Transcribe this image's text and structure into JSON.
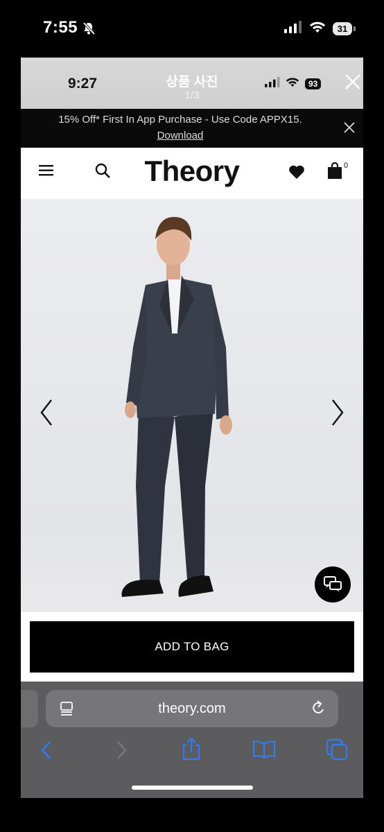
{
  "outer_status": {
    "time": "7:55",
    "battery": "31"
  },
  "viewer": {
    "time": "9:27",
    "title": "상품 사진",
    "counter": "1/3",
    "battery": "93"
  },
  "promo": {
    "text": "15% Off* First In App Purchase - Use Code APPX15.",
    "link": "Download"
  },
  "header": {
    "logo": "Theory",
    "cart_count": "0"
  },
  "product": {
    "add_to_bag": "ADD TO BAG"
  },
  "browser": {
    "url": "theory.com"
  },
  "icons": [
    "bell-slash-icon",
    "signal-icon",
    "wifi-icon",
    "battery-icon",
    "close-icon",
    "menu-icon",
    "search-icon",
    "heart-icon",
    "bag-icon",
    "chevron-left-icon",
    "chevron-right-icon",
    "chat-icon",
    "reader-icon",
    "reload-icon",
    "back-icon",
    "forward-icon",
    "share-icon",
    "bookmarks-icon",
    "tabs-icon"
  ],
  "colors": {
    "safari_blue": "#2f7df6",
    "black": "#000000"
  }
}
